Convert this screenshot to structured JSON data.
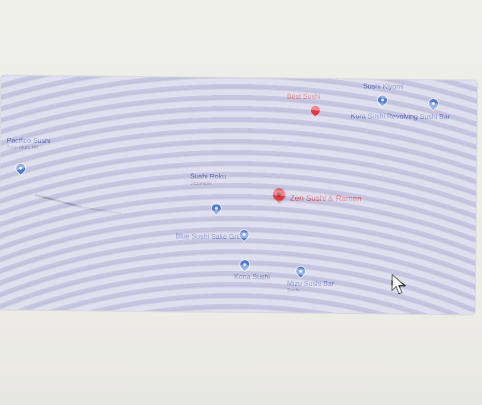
{
  "map": {
    "pois": [
      {
        "name": "Pacifico Sushi",
        "sub": "Tuen Mun, HK",
        "type": "blue"
      },
      {
        "name": "Sushi Kiyomi",
        "sub": "",
        "type": "blue"
      },
      {
        "name": "Best Sushi",
        "sub": "",
        "type": "red-small"
      },
      {
        "name": "Kura Sushi Revolving Sushi Bar",
        "sub": "",
        "type": "blue"
      },
      {
        "name": "Sushi Roku",
        "sub": "Japanese",
        "type": "blue"
      },
      {
        "name": "Blue Sushi Sake Grill",
        "sub": "",
        "type": "blue"
      },
      {
        "name": "",
        "sub": "",
        "type": "blue"
      },
      {
        "name": "Kona Sushi",
        "sub": "",
        "type": "blue"
      },
      {
        "name": "Mizu Sushi Bar",
        "sub": "Sushi",
        "type": "blue"
      }
    ],
    "selected_place": {
      "name": "Zen Sushi & Ramen",
      "type": "red"
    }
  },
  "colors": {
    "map_background": "#c9c9e4",
    "poi_blue": "#4d7bd8",
    "poi_red": "#e2343f",
    "label_blue": "#4f62b8",
    "label_red": "#d24a52"
  },
  "icons": {
    "cursor": "mouse-pointer-icon",
    "pin_blue": "map-pin-icon",
    "pin_red": "selected-map-pin-icon"
  }
}
